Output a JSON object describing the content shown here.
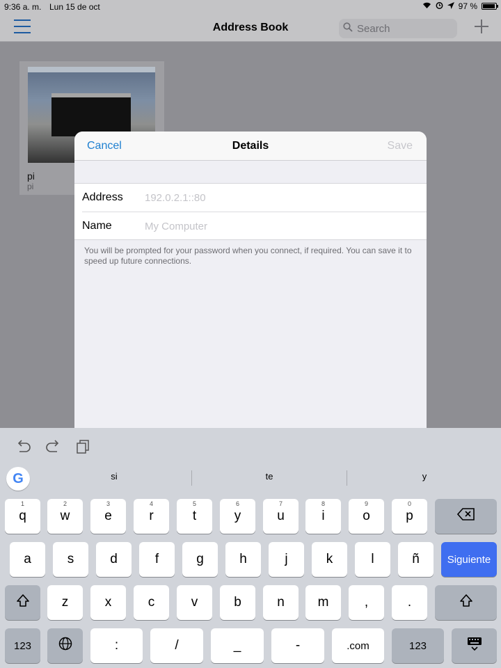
{
  "status_bar": {
    "time": "9:36 a. m.",
    "date": "Lun 15 de oct",
    "battery": "97 %",
    "battery_level": 0.97
  },
  "nav_bar": {
    "title": "Address Book",
    "search_placeholder": "Search"
  },
  "computers": [
    {
      "name": "pi",
      "subtitle": "pi"
    }
  ],
  "modal": {
    "title": "Details",
    "cancel_label": "Cancel",
    "save_label": "Save",
    "fields": [
      {
        "label": "Address",
        "value": "",
        "placeholder": "192.0.2.1::80"
      },
      {
        "label": "Name",
        "value": "",
        "placeholder": "My Computer"
      }
    ],
    "note": "You will be prompted for your password when you connect, if required. You can save it to speed up future connections."
  },
  "keyboard": {
    "suggestions": [
      "si",
      "te",
      "y"
    ],
    "row1": [
      {
        "hint": "1",
        "key": "q"
      },
      {
        "hint": "2",
        "key": "w"
      },
      {
        "hint": "3",
        "key": "e"
      },
      {
        "hint": "4",
        "key": "r"
      },
      {
        "hint": "5",
        "key": "t"
      },
      {
        "hint": "6",
        "key": "y"
      },
      {
        "hint": "7",
        "key": "u"
      },
      {
        "hint": "8",
        "key": "i"
      },
      {
        "hint": "9",
        "key": "o"
      },
      {
        "hint": "0",
        "key": "p"
      }
    ],
    "row2": [
      "a",
      "s",
      "d",
      "f",
      "g",
      "h",
      "j",
      "k",
      "l",
      "ñ"
    ],
    "return_label": "Siguiente",
    "row3": [
      "z",
      "x",
      "c",
      "v",
      "b",
      "n",
      "m",
      ",",
      "."
    ],
    "row4": {
      "numbers_left": "123",
      "colon": ":",
      "slash": "/",
      "underscore": "_",
      "dash": "-",
      "dotcom": ".com",
      "numbers_right": "123"
    }
  }
}
